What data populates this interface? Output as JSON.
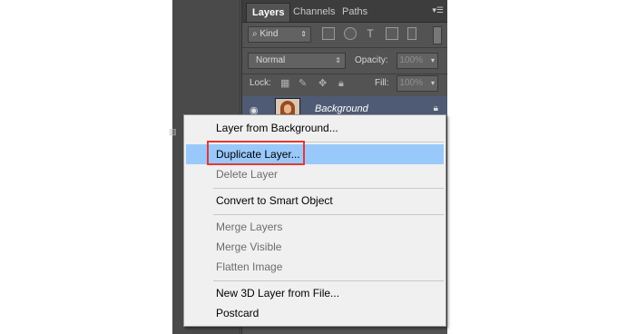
{
  "panel": {
    "tabs": [
      "Layers",
      "Channels",
      "Paths"
    ],
    "menu_icon": "panel-menu-icon",
    "filter": {
      "kind_label": "Kind",
      "icons": [
        "pixel-filter-icon",
        "adjustment-filter-icon",
        "type-filter-icon",
        "shape-filter-icon",
        "smart-object-filter-icon"
      ]
    },
    "blend_mode": "Normal",
    "opacity_label": "Opacity:",
    "opacity_value": "100%",
    "lock_label": "Lock:",
    "fill_label": "Fill:",
    "fill_value": "100%",
    "layer": {
      "name": "Background",
      "locked": true
    }
  },
  "context_menu": {
    "items": [
      {
        "label": "Layer from Background...",
        "enabled": true
      },
      {
        "label": "Duplicate Layer...",
        "enabled": true,
        "highlighted": true
      },
      {
        "label": "Delete Layer",
        "enabled": false
      },
      {
        "label": "Convert to Smart Object",
        "enabled": true
      },
      {
        "label": "Merge Layers",
        "enabled": false
      },
      {
        "label": "Merge Visible",
        "enabled": false
      },
      {
        "label": "Flatten Image",
        "enabled": false
      },
      {
        "label": "New 3D Layer from File...",
        "enabled": true
      },
      {
        "label": "Postcard",
        "enabled": true
      }
    ],
    "highlight_color": "#99c9fa",
    "annotation_color": "#e53935"
  }
}
